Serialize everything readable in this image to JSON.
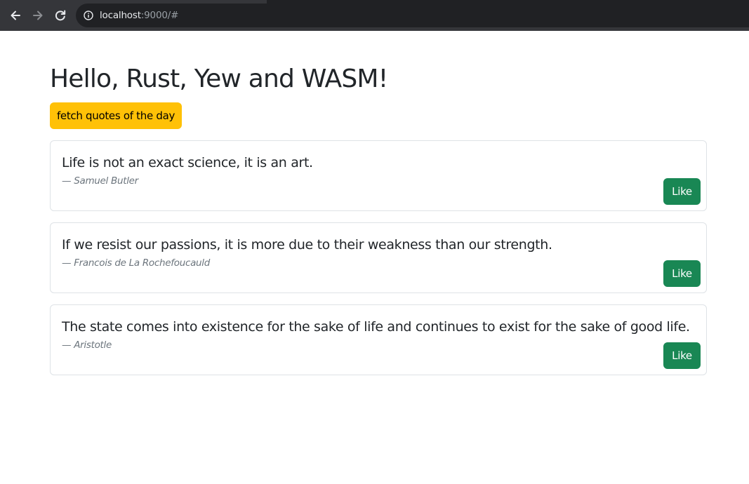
{
  "browser": {
    "url_host": "localhost",
    "url_rest": ":9000/#",
    "back_icon": "arrow-left-icon",
    "forward_icon": "arrow-right-icon",
    "reload_icon": "reload-icon",
    "info_icon": "info-icon"
  },
  "page": {
    "title": "Hello, Rust, Yew and WASM!",
    "fetch_button_label": "fetch quotes of the day"
  },
  "quotes": [
    {
      "text": "Life is not an exact science, it is an art.",
      "dash": "—",
      "author": "Samuel Butler",
      "like_label": "Like"
    },
    {
      "text": "If we resist our passions, it is more due to their weakness than our strength.",
      "dash": "—",
      "author": "Francois de La Rochefoucauld",
      "like_label": "Like"
    },
    {
      "text": "The state comes into existence for the sake of life and continues to exist for the sake of good life.",
      "dash": "—",
      "author": "Aristotle",
      "like_label": "Like"
    }
  ],
  "colors": {
    "warning": "#ffc107",
    "success": "#198754",
    "muted": "#6c757d",
    "chrome_bg": "#35363a"
  }
}
